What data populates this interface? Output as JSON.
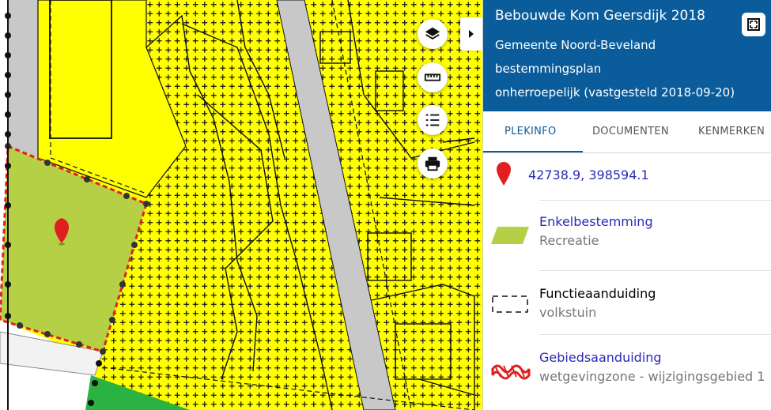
{
  "map": {
    "colors": {
      "bestemming_yellow": "#ffff00",
      "recreatie_green": "#b5d044",
      "road_grey": "#c8c8c8",
      "groen": "#2bb341",
      "marker": "#e02020"
    },
    "tools": [
      {
        "name": "layers-icon"
      },
      {
        "name": "ruler-icon"
      },
      {
        "name": "legend-list-icon"
      },
      {
        "name": "print-icon"
      }
    ]
  },
  "panel": {
    "header": {
      "title": "Bebouwde Kom Geersdijk 2018",
      "municipality": "Gemeente Noord-Beveland",
      "plan_type": "bestemmingsplan",
      "status": "onherroepelijk (vastgesteld 2018-09-20)",
      "background": "#0b5c9a"
    },
    "tabs": [
      {
        "label": "PLEKINFO",
        "active": true
      },
      {
        "label": "DOCUMENTEN",
        "active": false
      },
      {
        "label": "KENMERKEN",
        "active": false
      }
    ],
    "location": {
      "coordinates": "42738.9, 398594.1"
    },
    "items": [
      {
        "title": "Enkelbestemming",
        "subtitle": "Recreatie",
        "link": true,
        "icon": "recreatie-swatch-icon"
      },
      {
        "title": "Functieaanduiding",
        "subtitle": "volkstuin",
        "link": false,
        "icon": "dashed-box-icon"
      },
      {
        "title": "Gebiedsaanduiding",
        "subtitle": "wetgevingzone - wijzigingsgebied 1",
        "link": true,
        "icon": "hatched-zone-icon"
      }
    ]
  }
}
